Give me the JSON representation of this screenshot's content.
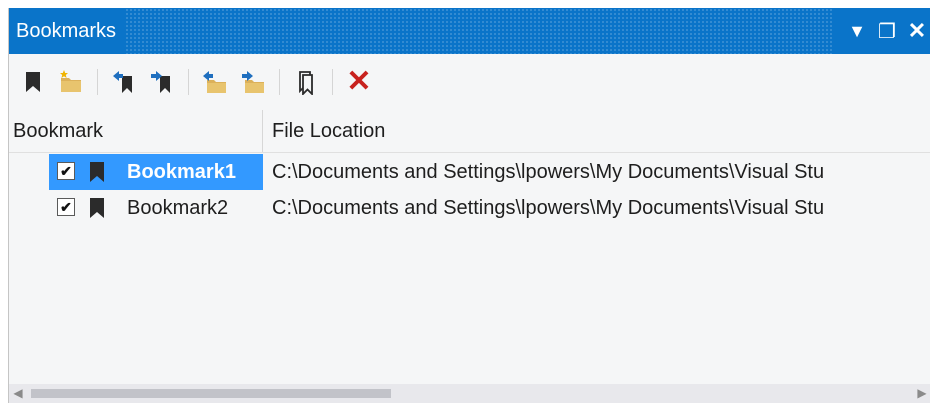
{
  "window": {
    "title": "Bookmarks",
    "controls": {
      "dropdown": "▼",
      "restore": "❐",
      "close": "✕"
    }
  },
  "toolbar": {
    "delete_glyph": "✕",
    "accent_color": "#c8221e"
  },
  "columns": {
    "bookmark": "Bookmark",
    "file_location": "File Location"
  },
  "rows": [
    {
      "checked": true,
      "check_glyph": "✔",
      "name": "Bookmark1",
      "path": "C:\\Documents and Settings\\lpowers\\My Documents\\Visual Stu",
      "selected": true,
      "icon": "bookmark-icon"
    },
    {
      "checked": true,
      "check_glyph": "✔",
      "name": "Bookmark2",
      "path": "C:\\Documents and Settings\\lpowers\\My Documents\\Visual Stu",
      "selected": false,
      "icon": "bookmark-icon"
    }
  ],
  "scrollbar": {
    "left_arrow": "◀",
    "right_arrow": "▶"
  },
  "colors": {
    "titlebar": "#0a74c9",
    "selection": "#3399ff"
  }
}
